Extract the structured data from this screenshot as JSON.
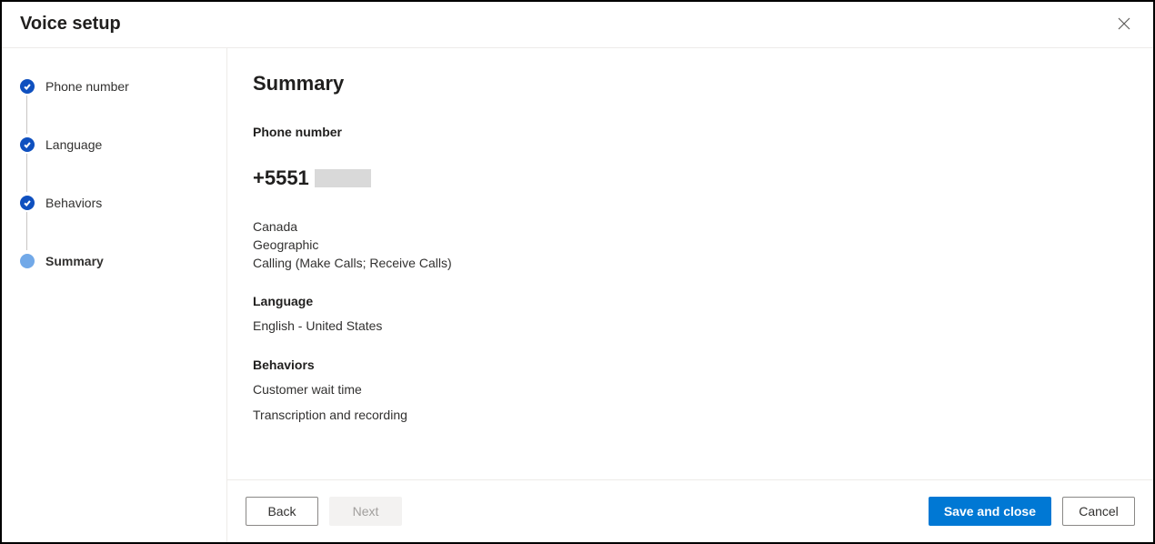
{
  "header": {
    "title": "Voice setup"
  },
  "sidebar": {
    "steps": [
      {
        "label": "Phone number",
        "state": "completed"
      },
      {
        "label": "Language",
        "state": "completed"
      },
      {
        "label": "Behaviors",
        "state": "completed"
      },
      {
        "label": "Summary",
        "state": "current"
      }
    ]
  },
  "main": {
    "title": "Summary",
    "phone_section": {
      "label": "Phone number",
      "number_prefix": "+5551",
      "country": "Canada",
      "type": "Geographic",
      "features": "Calling (Make Calls; Receive Calls)"
    },
    "language_section": {
      "label": "Language",
      "value": "English - United States"
    },
    "behaviors_section": {
      "label": "Behaviors",
      "items": [
        "Customer wait time",
        "Transcription and recording"
      ]
    }
  },
  "footer": {
    "back": "Back",
    "next": "Next",
    "save": "Save and close",
    "cancel": "Cancel"
  }
}
